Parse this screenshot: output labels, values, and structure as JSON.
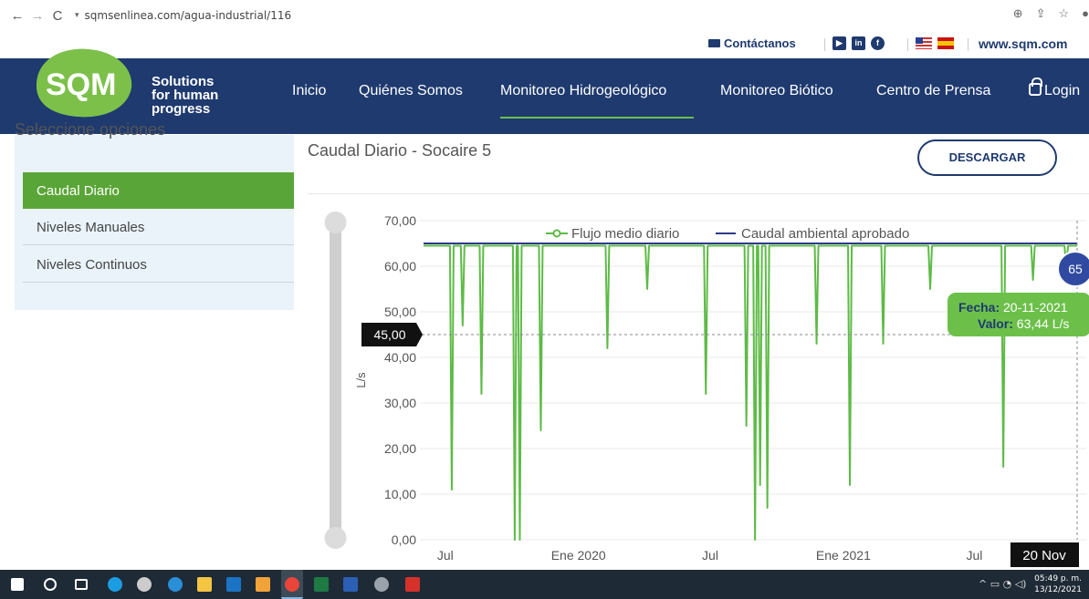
{
  "browser": {
    "url": "sqmsenlinea.com/agua-industrial/116"
  },
  "utility": {
    "contact_label": "Contáctanos",
    "site_link": "www.sqm.com"
  },
  "header": {
    "logo_text": "SQM",
    "tagline_1": "Solutions",
    "tagline_2": "for human",
    "tagline_3": "progress",
    "nav": [
      "Inicio",
      "Quiénes Somos",
      "Monitoreo Hidrogeológico",
      "Monitoreo Biótico",
      "Centro de Prensa",
      "Login"
    ],
    "active_nav": "Monitoreo Hidrogeológico"
  },
  "sidebar": {
    "heading": "Seleccione opciones",
    "items": [
      {
        "label": "Caudal Diario",
        "active": true
      },
      {
        "label": "Niveles Manuales",
        "active": false
      },
      {
        "label": "Niveles Continuos",
        "active": false
      }
    ]
  },
  "main": {
    "chart_title": "Caudal Diario - Socaire 5",
    "download_label": "DESCARGAR"
  },
  "colors": {
    "navy": "#1e3a6f",
    "green": "#6cc04a",
    "series_green": "#5dbb46",
    "series_blue": "#2b3a8c",
    "sidebar_bg": "#e9f3f9"
  },
  "chart_data": {
    "type": "line",
    "ylabel": "L/s",
    "ylim": [
      0,
      70
    ],
    "y_ticks": [
      "0,00",
      "10,00",
      "20,00",
      "30,00",
      "40,00",
      "50,00",
      "60,00",
      "70,00"
    ],
    "x_ticks": [
      "Jul",
      "Ene 2020",
      "Jul",
      "Ene 2021",
      "Jul"
    ],
    "x_range": [
      "2019-06-01",
      "2021-11-20"
    ],
    "series": [
      {
        "name": "Flujo medio diario",
        "baseline": 64.5,
        "dips": [
          {
            "date": "2019-07-10",
            "value": 11
          },
          {
            "date": "2019-07-25",
            "value": 47
          },
          {
            "date": "2019-08-20",
            "value": 32
          },
          {
            "date": "2019-10-05",
            "value": 0
          },
          {
            "date": "2019-10-12",
            "value": 0
          },
          {
            "date": "2019-11-10",
            "value": 24
          },
          {
            "date": "2020-02-10",
            "value": 42
          },
          {
            "date": "2020-04-05",
            "value": 55
          },
          {
            "date": "2020-06-25",
            "value": 32
          },
          {
            "date": "2020-08-20",
            "value": 25
          },
          {
            "date": "2020-09-01",
            "value": 0
          },
          {
            "date": "2020-09-08",
            "value": 12
          },
          {
            "date": "2020-09-18",
            "value": 7
          },
          {
            "date": "2020-11-25",
            "value": 43
          },
          {
            "date": "2021-01-10",
            "value": 12
          },
          {
            "date": "2021-02-25",
            "value": 43
          },
          {
            "date": "2021-05-01",
            "value": 55
          },
          {
            "date": "2021-08-10",
            "value": 16
          },
          {
            "date": "2021-09-20",
            "value": 57
          },
          {
            "date": "2021-11-05",
            "value": 60
          }
        ]
      },
      {
        "name": "Caudal ambiental aprobado",
        "value": 65
      }
    ],
    "crosshair_y": "45,00",
    "tooltip": {
      "fecha_label": "Fecha:",
      "fecha": "20-11-2021",
      "valor_label": "Valor:",
      "valor": "63,44 L/s",
      "marker": "65",
      "x_badge": "20 Nov"
    }
  },
  "taskbar": {
    "time": "05:49 p. m.",
    "date": "13/12/2021"
  }
}
